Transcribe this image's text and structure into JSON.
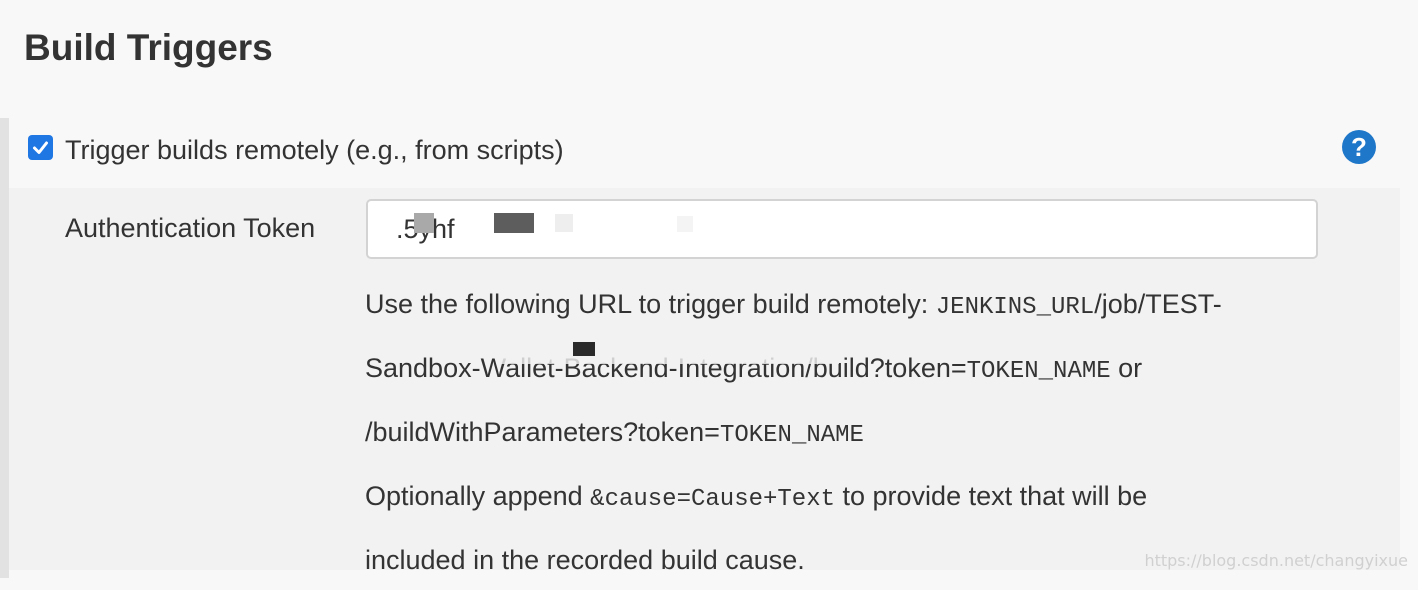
{
  "section": {
    "title": "Build Triggers"
  },
  "trigger": {
    "checkbox_label": "Trigger builds remotely (e.g., from scripts)",
    "checked": true,
    "help_glyph": "?"
  },
  "token": {
    "label": "Authentication Token",
    "value": ".5yhf"
  },
  "help": {
    "line1_text": "Use the following URL to trigger build remotely: ",
    "line1_code": "JENKINS_URL",
    "line1_tail": "/job/TEST-",
    "line2_text": "Sandbox-Wallet-Backend-Integration/build?token=",
    "line2_code": "TOKEN_NAME",
    "line2_tail": " or",
    "line3_text": "/buildWithParameters?token=",
    "line3_code": "TOKEN_NAME",
    "line4_text": "Optionally append ",
    "line4_code": "&cause=Cause+Text",
    "line4_tail": " to provide text that will be",
    "line5_text": "included in the recorded build cause."
  },
  "watermark": "https://blog.csdn.net/changyixue",
  "colors": {
    "accent": "#1f77e4",
    "help_icon": "#1f77c9",
    "panel": "#f2f2f2",
    "page": "#f8f8f8"
  },
  "icons": {
    "checkbox": "check-icon",
    "help": "help-circle-icon"
  }
}
